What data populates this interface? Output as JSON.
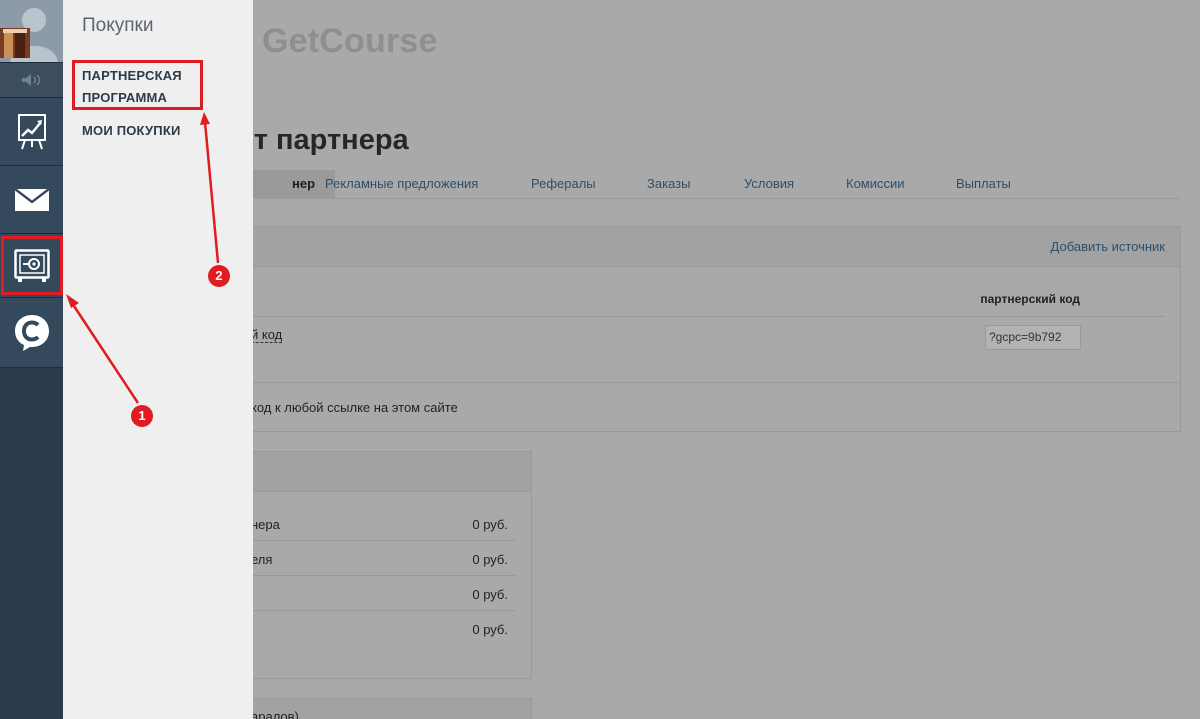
{
  "brand": "GetCourse",
  "page_title": "ет партнера",
  "tabs": [
    {
      "label": "нер",
      "active": true
    },
    {
      "label": "Рекламные предложения",
      "active": false
    },
    {
      "label": "Рефералы",
      "active": false
    },
    {
      "label": "Заказы",
      "active": false
    },
    {
      "label": "Условия",
      "active": false
    },
    {
      "label": "Комиссии",
      "active": false
    },
    {
      "label": "Выплаты",
      "active": false
    }
  ],
  "sources_panel": {
    "add_source": "Добавить источник",
    "column_header": "партнерский код",
    "row_label": "й код",
    "code_value": "?gcpc=9b792",
    "footer_text": "код к любой ссылке на этом сайте"
  },
  "stats_panel": {
    "rows": [
      {
        "label": "нера",
        "value": "0 руб."
      },
      {
        "label": "еля",
        "value": "0 руб."
      },
      {
        "label": "",
        "value": "0 руб."
      },
      {
        "label": "",
        "value": "0 руб."
      }
    ]
  },
  "bottom_panel_text": "аралов)",
  "sidebar": {
    "icons": [
      "avatar-icon",
      "speaker-icon",
      "chart-icon",
      "mail-icon",
      "wallet-icon",
      "chat-icon"
    ]
  },
  "flyout": {
    "title": "Покупки",
    "items": [
      {
        "label": "ПАРТНЕРСКАЯ ПРОГРАММА"
      },
      {
        "label": "МОИ ПОКУПКИ"
      }
    ]
  },
  "annotations": {
    "badge1": "1",
    "badge2": "2"
  },
  "colors": {
    "annotation_red": "#e11b22",
    "rail_bg": "#2b3b4b",
    "link_blue": "#2d4f6b"
  }
}
